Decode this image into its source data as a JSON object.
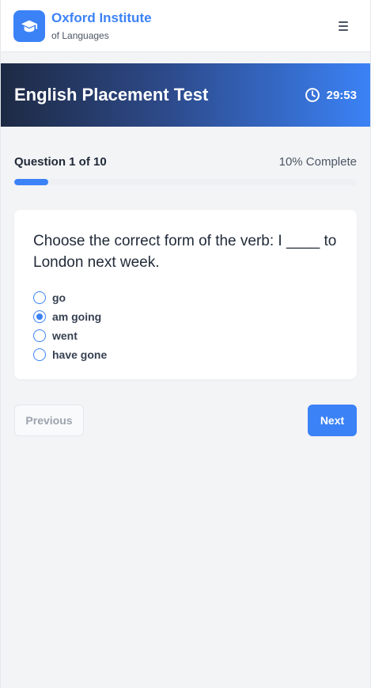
{
  "header": {
    "brand_name": "Oxford Institute",
    "brand_sub": "of Languages",
    "logo_icon": "graduation-cap-icon",
    "menu_icon": "hamburger-menu-icon"
  },
  "banner": {
    "title": "English Placement Test",
    "timer_icon": "clock-icon",
    "timer_value": "29:53"
  },
  "progress": {
    "label": "Question 1 of 10",
    "percent_text": "10% Complete",
    "percent": 10
  },
  "question": {
    "text": "Choose the correct form of the verb: I ____ to London next week.",
    "options": [
      {
        "label": "go",
        "selected": false
      },
      {
        "label": "am going",
        "selected": true
      },
      {
        "label": "went",
        "selected": false
      },
      {
        "label": "have gone",
        "selected": false
      }
    ]
  },
  "nav": {
    "previous_label": "Previous",
    "next_label": "Next"
  },
  "colors": {
    "accent": "#3b82f6",
    "banner_dark": "#1e2a44"
  }
}
